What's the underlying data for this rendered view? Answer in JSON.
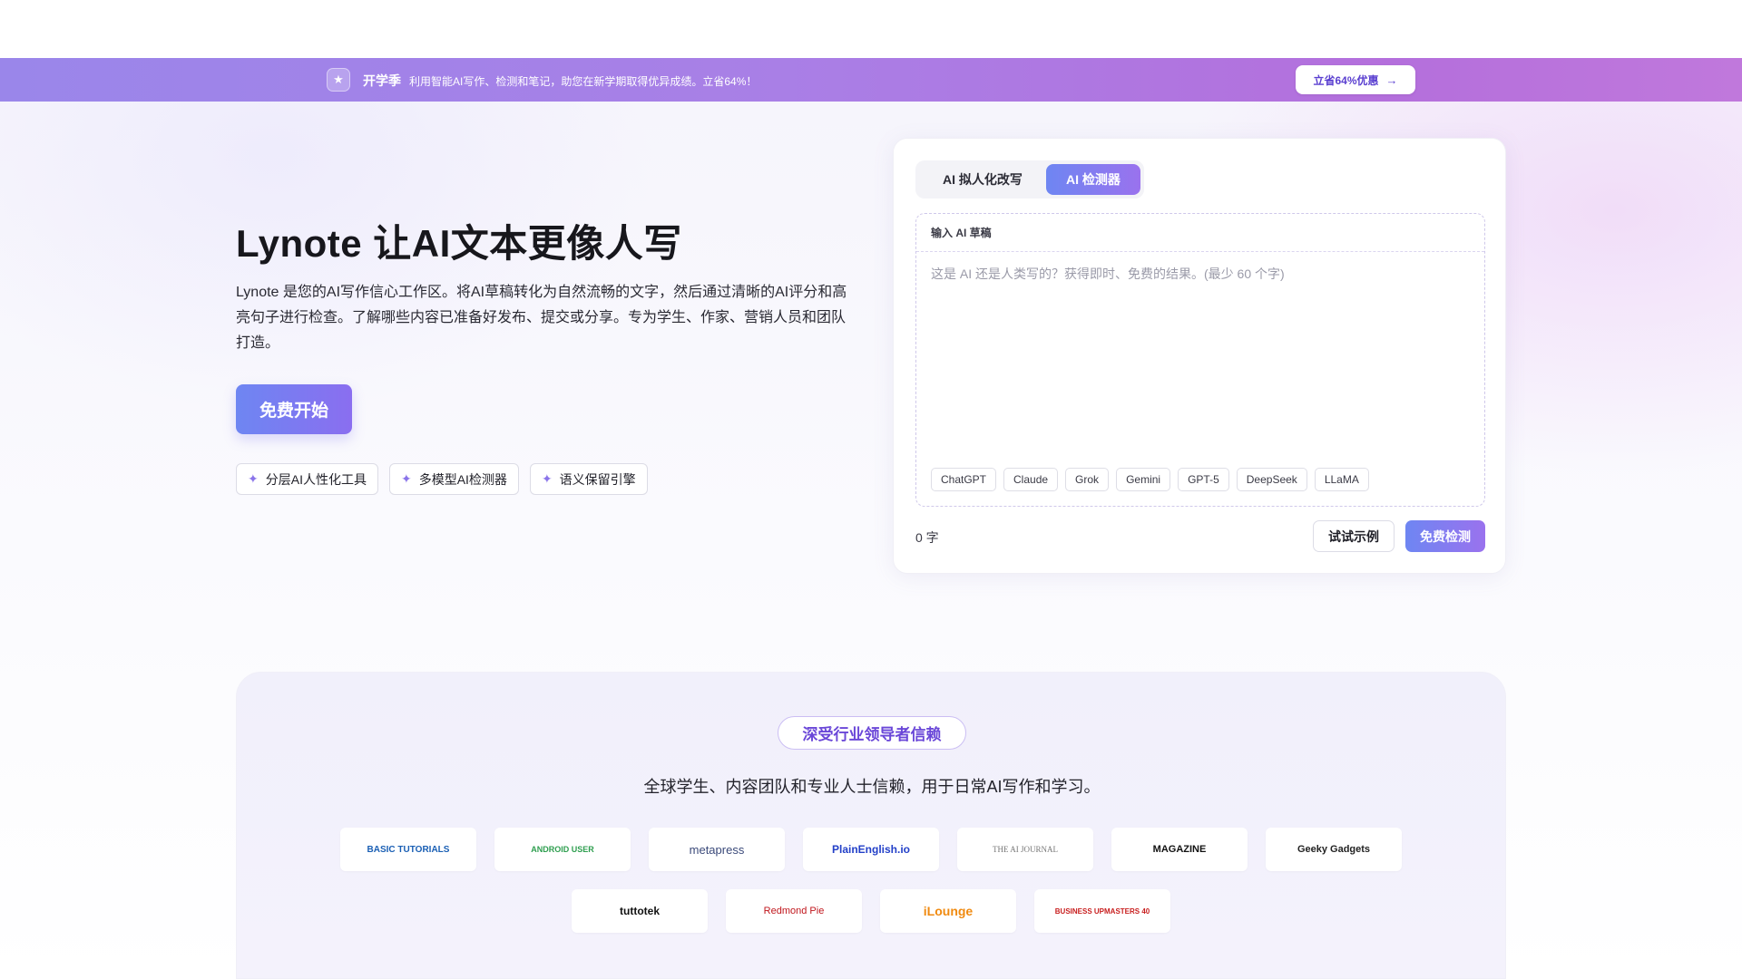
{
  "promo": {
    "title": "开学季",
    "text": "利用智能AI写作、检测和笔记，助您在新学期取得优异成绩。立省64%！",
    "button": "立省64%优惠",
    "star_icon": "star-icon",
    "arrow_icon": "arrow-right-icon"
  },
  "hero": {
    "title": "Lynote 让AI文本更像人写",
    "description": "Lynote 是您的AI写作信心工作区。将AI草稿转化为自然流畅的文字，然后通过清晰的AI评分和高亮句子进行检查。了解哪些内容已准备好发布、提交或分享。专为学生、作家、营销人员和团队打造。",
    "cta": "免费开始",
    "features": [
      "分层AI人性化工具",
      "多模型AI检测器",
      "语义保留引擎"
    ]
  },
  "detector": {
    "tabs": [
      "AI 拟人化改写",
      "AI 检测器"
    ],
    "active_tab": "AI 检测器",
    "editor_label": "输入 AI 草稿",
    "input_value": "",
    "placeholder": "这是 AI 还是人类写的？获得即时、免费的结果。(最少 60 个字)",
    "models": [
      "ChatGPT",
      "Claude",
      "Grok",
      "Gemini",
      "GPT-5",
      "DeepSeek",
      "LLaMA"
    ],
    "word_count": "0 字",
    "sample_button": "试试示例",
    "detect_button": "免费检测"
  },
  "trust": {
    "badge": "深受行业领导者信赖",
    "subtitle": "全球学生、内容团队和专业人士信赖，用于日常AI写作和学习。",
    "logos": [
      "BASIC TUTORIALS",
      "ANDROID USER",
      "metapress",
      "PlainEnglish.io",
      "THE AI JOURNAL",
      "MAGAZINE",
      "Geeky Gadgets",
      "tuttotek",
      "Redmond Pie",
      "iLounge",
      "BUSINESS UPMASTERS 40"
    ]
  },
  "colors": {
    "accent_start": "#6e86f2",
    "accent_end": "#9a72ee",
    "promo_start": "#9a86ea",
    "promo_end": "#c078dc",
    "badge_text": "#6a47d8"
  }
}
